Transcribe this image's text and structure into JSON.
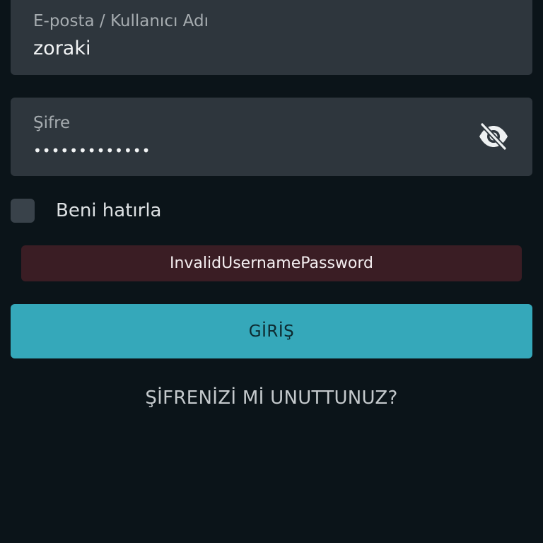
{
  "login_form": {
    "username": {
      "label": "E-posta / Kullanıcı Adı",
      "value": "zoraki"
    },
    "password": {
      "label": "Şifre",
      "masked_value": "•••••••••••••",
      "toggle_icon": "eye-off-icon"
    },
    "remember_me": {
      "label": "Beni hatırla",
      "checked": false
    },
    "error": {
      "message": "InvalidUsernamePassword",
      "background": "#3a1d24"
    },
    "submit": {
      "label": "GİRİŞ",
      "background": "#35a8ba"
    },
    "forgot_password": {
      "label": "ŞİFRENİZİ Mİ UNUTTUNUZ?"
    }
  },
  "theme": {
    "page_background": "#0b1419",
    "field_background": "#2e363d"
  }
}
